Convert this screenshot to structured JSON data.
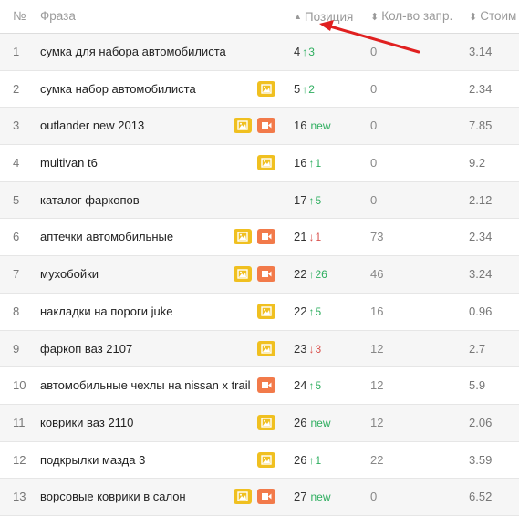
{
  "header": {
    "num": "№",
    "phrase": "Фраза",
    "position": "Позиция",
    "count": "Кол-во запр.",
    "cost": "Стоим"
  },
  "rows": [
    {
      "num": "1",
      "phrase": "сумка для набора автомобилиста",
      "pos": "4",
      "dir": "↑",
      "chg": "3",
      "cnt": "0",
      "cost": "3.14",
      "icons": []
    },
    {
      "num": "2",
      "phrase": "сумка набор автомобилиста",
      "pos": "5",
      "dir": "↑",
      "chg": "2",
      "cnt": "0",
      "cost": "2.34",
      "icons": [
        "image"
      ]
    },
    {
      "num": "3",
      "phrase": "outlander new 2013",
      "pos": "16",
      "dir": "",
      "chg": "new",
      "cnt": "0",
      "cost": "7.85",
      "icons": [
        "image",
        "video"
      ]
    },
    {
      "num": "4",
      "phrase": "multivan t6",
      "pos": "16",
      "dir": "↑",
      "chg": "1",
      "cnt": "0",
      "cost": "9.2",
      "icons": [
        "image"
      ]
    },
    {
      "num": "5",
      "phrase": "каталог фаркопов",
      "pos": "17",
      "dir": "↑",
      "chg": "5",
      "cnt": "0",
      "cost": "2.12",
      "icons": []
    },
    {
      "num": "6",
      "phrase": "аптечки автомобильные",
      "pos": "21",
      "dir": "↓",
      "chg": "1",
      "cnt": "73",
      "cost": "2.34",
      "icons": [
        "image",
        "video"
      ]
    },
    {
      "num": "7",
      "phrase": "мухобойки",
      "pos": "22",
      "dir": "↑",
      "chg": "26",
      "cnt": "46",
      "cost": "3.24",
      "icons": [
        "image",
        "video"
      ]
    },
    {
      "num": "8",
      "phrase": "накладки на пороги juke",
      "pos": "22",
      "dir": "↑",
      "chg": "5",
      "cnt": "16",
      "cost": "0.96",
      "icons": [
        "image"
      ]
    },
    {
      "num": "9",
      "phrase": "фаркоп ваз 2107",
      "pos": "23",
      "dir": "↓",
      "chg": "3",
      "cnt": "12",
      "cost": "2.7",
      "icons": [
        "image"
      ]
    },
    {
      "num": "10",
      "phrase": "автомобильные чехлы на nissan x trail",
      "pos": "24",
      "dir": "↑",
      "chg": "5",
      "cnt": "12",
      "cost": "5.9",
      "icons": [
        "video"
      ]
    },
    {
      "num": "11",
      "phrase": "коврики ваз 2110",
      "pos": "26",
      "dir": "",
      "chg": "new",
      "cnt": "12",
      "cost": "2.06",
      "icons": [
        "image"
      ]
    },
    {
      "num": "12",
      "phrase": "подкрылки мазда 3",
      "pos": "26",
      "dir": "↑",
      "chg": "1",
      "cnt": "22",
      "cost": "3.59",
      "icons": [
        "image"
      ]
    },
    {
      "num": "13",
      "phrase": "ворсовые коврики в салон",
      "pos": "27",
      "dir": "",
      "chg": "new",
      "cnt": "0",
      "cost": "6.52",
      "icons": [
        "image",
        "video"
      ]
    }
  ],
  "colors": {
    "up": "#2eae5f",
    "down": "#d9534f",
    "image_icon": "#f0c020",
    "video_icon": "#f27a4a",
    "annotation_arrow": "#e02020"
  },
  "icon_names": {
    "image": "image-icon",
    "video": "video-camera-icon"
  }
}
